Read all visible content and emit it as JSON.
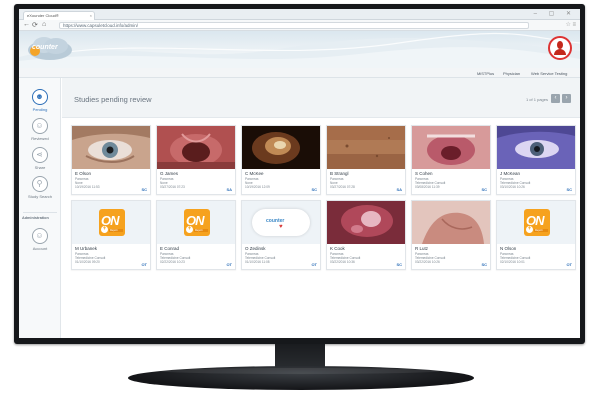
{
  "browser": {
    "tab_title": "eXounder Cloud®",
    "tab_close": "×",
    "url": "https://www.capsuletcloud.info/admin/",
    "window_controls": "–  ▢  ✕"
  },
  "app": {
    "logo_text": "counter"
  },
  "header_links": [
    "MiSTPlus",
    "Physician",
    "Web Service Testing"
  ],
  "sidebar": {
    "items": [
      {
        "label": "Pending",
        "icon": "pending-icon",
        "active": true
      },
      {
        "label": "Reviewed",
        "icon": "reviewed-icon",
        "active": false
      },
      {
        "label": "Share",
        "icon": "share-icon",
        "active": false
      },
      {
        "label": "Study Search",
        "icon": "search-icon",
        "active": false
      }
    ],
    "admin_heading": "Administration",
    "admin_items": [
      {
        "label": "Account",
        "icon": "account-icon"
      }
    ]
  },
  "main": {
    "title": "Studies pending review",
    "pager_text": "1 of 1 pages",
    "prev": "‹",
    "next": "›"
  },
  "studies": [
    {
      "name": "E Olson",
      "l1": "Pancreas",
      "l2": "None",
      "l3": "10/19/2016 11:53",
      "tag": "SC",
      "thumb": "eye"
    },
    {
      "name": "G James",
      "l1": "Pancreas",
      "l2": "None",
      "l3": "03/27/2016 07:23",
      "tag": "SA",
      "thumb": "throat"
    },
    {
      "name": "C McKee",
      "l1": "Pancreas",
      "l2": "None",
      "l3": "10/19/2016 12:09",
      "tag": "SC",
      "thumb": "ear"
    },
    {
      "name": "B Strangl",
      "l1": "Pancreas",
      "l2": "None",
      "l3": "03/27/2016 07:28",
      "tag": "SA",
      "thumb": "skin"
    },
    {
      "name": "S Cohen",
      "l1": "Pancreas",
      "l2": "Telemedicine Consult",
      "l3": "03/08/2016 11:39",
      "tag": "SC",
      "thumb": "mouth"
    },
    {
      "name": "J McKean",
      "l1": "Pancreas",
      "l2": "Telemedicine Consult",
      "l3": "03/10/2016 10:26",
      "tag": "SC",
      "thumb": "eye2"
    },
    {
      "name": "M Urbanek",
      "l1": "Pancreas",
      "l2": "Telemedicine Consult",
      "l3": "01/10/2016 09:20",
      "tag": "OT",
      "thumb": "on"
    },
    {
      "name": "E Conrad",
      "l1": "Pancreas",
      "l2": "Telemedicine Consult",
      "l3": "02/22/2016 10:23",
      "tag": "OT",
      "thumb": "on"
    },
    {
      "name": "O Zedinsk",
      "l1": "Pancreas",
      "l2": "Telemedicine Consult",
      "l3": "01/10/2016 11:08",
      "tag": "OT",
      "thumb": "cloud"
    },
    {
      "name": "K Cook",
      "l1": "Pancreas",
      "l2": "Telemedicine Consult",
      "l3": "03/22/2016 10:36",
      "tag": "SC",
      "thumb": "tissue"
    },
    {
      "name": "R Lutz",
      "l1": "Pancreas",
      "l2": "Telemedicine Consult",
      "l3": "03/22/2016 10:26",
      "tag": "SC",
      "thumb": "hand"
    },
    {
      "name": "N Olson",
      "l1": "Pancreas",
      "l2": "Telemedicine Consult",
      "l3": "02/10/2016 10:01",
      "tag": "OT",
      "thumb": "on"
    }
  ],
  "badges": {
    "on_text": "ON",
    "on_plus": "+",
    "on_strip": "Report",
    "cloud_text": "counter",
    "cloud_heart": "♥"
  },
  "colors": {
    "accent": "#2d6fb8",
    "badge_orange": "#f6a21e",
    "record_red": "#c4281c"
  }
}
